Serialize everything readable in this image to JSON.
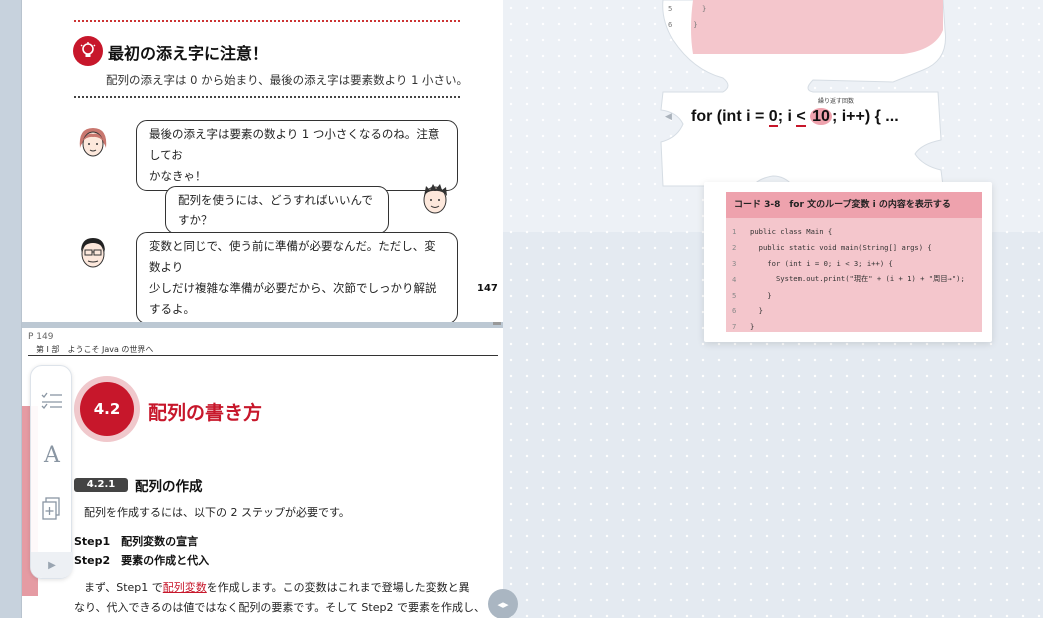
{
  "top_page": {
    "caution_title": "最初の添え字に注意！",
    "caution_text": "配列の添え字は 0 から始まり、最後の添え字は要素数より 1 小さい。",
    "dialogue": [
      {
        "speaker": "woman",
        "lines": [
          "最後の添え字は要素の数より 1 つ小さくなるのね。注意してお",
          "かなきゃ！"
        ]
      },
      {
        "speaker": "student",
        "lines": [
          "配列を使うには、どうすればいいんですか？"
        ]
      },
      {
        "speaker": "teacher",
        "lines": [
          "変数と同じで、使う前に準備が必要なんだ。ただし、変数より",
          "少しだけ複雑な準備が必要だから、次節でしっかり解説するよ。"
        ]
      }
    ],
    "page_number": "147"
  },
  "bottom_page": {
    "page_indicator": "P 149",
    "part_label": "第 I 部　ようこそ Java の世界へ",
    "section_number": "4.2",
    "section_title": "配列の書き方",
    "subsection_number": "4.2.1",
    "subsection_title": "配列の作成",
    "intro": "配列を作成するには、以下の 2 ステップが必要です。",
    "steps": [
      "Step1　配列変数の宣言",
      "Step2　要素の作成と代入"
    ],
    "para_line1_a": "まず、Step1 で",
    "para_line1_hl": "配列変数",
    "para_line1_b": "を作成します。この変数はこれまで登場した変数と異",
    "para_line2": "なり、代入できるのは値ではなく配列の要素です。そして Step2 で要素を作成し、"
  },
  "toolbar": {
    "tools": [
      {
        "icon": "list-checklist-icon"
      },
      {
        "icon": "text-font-icon",
        "label": "A"
      },
      {
        "icon": "add-page-icon"
      }
    ],
    "expand_icon": "chevron-right-icon"
  },
  "canvas": {
    "top_snippet_lines": [
      {
        "num": "5",
        "text": "    }"
      },
      {
        "num": "6",
        "text": "  }"
      }
    ],
    "loop_card": {
      "caption": "繰り返す回数",
      "code_prefix": "for (int i = ",
      "zero": "0",
      "mid": ";  i ",
      "lt": "<",
      "ten": "10",
      "suffix": ";  i++) { ..."
    },
    "code_listing": {
      "title": "コード 3-8　for 文のループ変数 i の内容を表示する",
      "lines": [
        {
          "num": "1",
          "text": "public class Main {"
        },
        {
          "num": "2",
          "text": "  public static void main(String[] args) {"
        },
        {
          "num": "3",
          "text": "    for (int i = 0; i < 3; i++) {"
        },
        {
          "num": "4",
          "text": "      System.out.print(\"現在\" + (i + 1) + \"周目→\");"
        },
        {
          "num": "5",
          "text": "    }"
        },
        {
          "num": "6",
          "text": "  }"
        },
        {
          "num": "7",
          "text": "}"
        }
      ]
    }
  },
  "colors": {
    "accent_red": "#c7172b",
    "code_header_pink": "#eea2ad",
    "code_body_pink": "#f4c6cc",
    "canvas_blue": "#e4eaf1"
  }
}
